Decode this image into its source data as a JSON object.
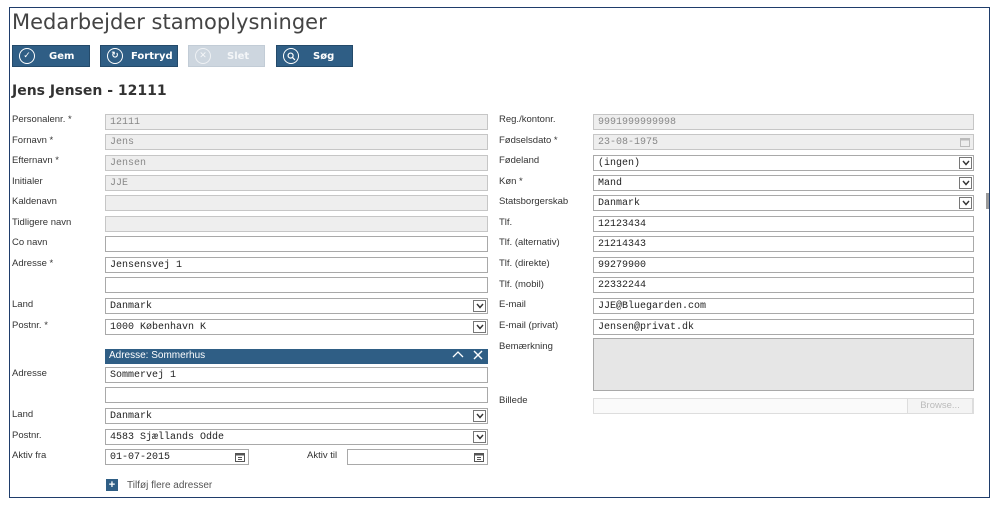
{
  "page": {
    "title": "Medarbejder stamoplysninger",
    "employee_heading": "Jens Jensen - 12111"
  },
  "toolbar": {
    "save_label": "Gem",
    "undo_label": "Fortryd",
    "delete_label": "Slet",
    "search_label": "Søg"
  },
  "left": {
    "personalenr": {
      "label": "Personalenr. *",
      "value": "12111"
    },
    "fornavn": {
      "label": "Fornavn *",
      "value": "Jens"
    },
    "efternavn": {
      "label": "Efternavn *",
      "value": "Jensen"
    },
    "initialer": {
      "label": "Initialer",
      "value": "JJE"
    },
    "kaldenavn": {
      "label": "Kaldenavn",
      "value": ""
    },
    "tidligere_navn": {
      "label": "Tidligere navn",
      "value": ""
    },
    "co_navn": {
      "label": "Co navn",
      "value": ""
    },
    "adresse": {
      "label": "Adresse *",
      "value": "Jensensvej 1",
      "value2": ""
    },
    "land": {
      "label": "Land",
      "value": "Danmark"
    },
    "postnr": {
      "label": "Postnr. *",
      "value": "1000 København K"
    }
  },
  "summerhouse": {
    "header": "Adresse: Sommerhus",
    "adresse": {
      "label": "Adresse",
      "value": "Sommervej 1",
      "value2": ""
    },
    "land": {
      "label": "Land",
      "value": "Danmark"
    },
    "postnr": {
      "label": "Postnr.",
      "value": "4583 Sjællands Odde"
    },
    "aktiv_fra": {
      "label": "Aktiv fra",
      "value": "01-07-2015"
    },
    "aktiv_til": {
      "label": "Aktiv til",
      "value": ""
    },
    "add_more_label": "Tilføj flere adresser"
  },
  "right": {
    "reg_konto": {
      "label": "Reg./kontonr.",
      "value": "9991999999998"
    },
    "foedselsdato": {
      "label": "Fødselsdato *",
      "value": "23-08-1975"
    },
    "foedeland": {
      "label": "Fødeland",
      "value": "(ingen)"
    },
    "koen": {
      "label": "Køn *",
      "value": "Mand"
    },
    "statsborgerskab": {
      "label": "Statsborgerskab",
      "value": "Danmark"
    },
    "tlf": {
      "label": "Tlf.",
      "value": "12123434"
    },
    "tlf_alternativ": {
      "label": "Tlf. (alternativ)",
      "value": "21214343"
    },
    "tlf_direkte": {
      "label": "Tlf. (direkte)",
      "value": "99279900"
    },
    "tlf_mobil": {
      "label": "Tlf. (mobil)",
      "value": "22332244"
    },
    "email": {
      "label": "E-mail",
      "value": "JJE@Bluegarden.com"
    },
    "email_privat": {
      "label": "E-mail (privat)",
      "value": "Jensen@privat.dk"
    },
    "bemaerkning": {
      "label": "Bemærkning"
    },
    "billede": {
      "label": "Billede",
      "browse_label": "Browse..."
    }
  },
  "icons": {
    "save": "check-circle-icon",
    "undo": "undo-circle-icon",
    "delete": "x-circle-icon",
    "search": "search-circle-icon",
    "dropdown": "chevron-down-icon",
    "calendar": "calendar-icon",
    "collapse": "chevron-up-icon",
    "close": "close-icon",
    "add": "plus-icon"
  },
  "colors": {
    "accent": "#2f5e85",
    "frame": "#1f3d6b",
    "readonly_bg": "#eeeeee"
  }
}
